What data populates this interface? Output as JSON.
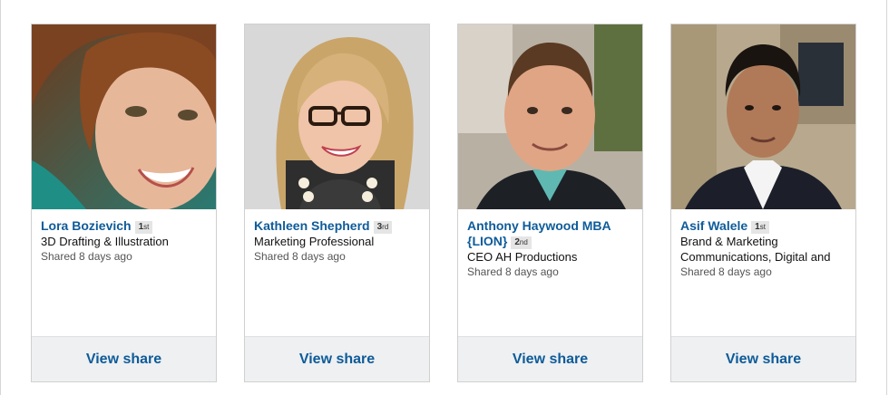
{
  "cards": [
    {
      "name": "Lora Bozievich",
      "degree_num": "1",
      "degree_suffix": "st",
      "headline": "3D Drafting & Illustration",
      "shared": "Shared 8 days ago",
      "action": "View share"
    },
    {
      "name": "Kathleen Shepherd",
      "degree_num": "3",
      "degree_suffix": "rd",
      "headline": "Marketing Professional",
      "shared": "Shared 8 days ago",
      "action": "View share"
    },
    {
      "name_line1": "Anthony Haywood MBA",
      "name_line2": "{LION}",
      "degree_num": "2",
      "degree_suffix": "nd",
      "headline": "CEO AH Productions",
      "shared": "Shared 8 days ago",
      "action": "View share"
    },
    {
      "name": "Asif Walele",
      "degree_num": "1",
      "degree_suffix": "st",
      "headline_line1": "Brand & Marketing",
      "headline_line2": "Communications, Digital and",
      "shared": "Shared 8 days ago",
      "action": "View share"
    }
  ]
}
